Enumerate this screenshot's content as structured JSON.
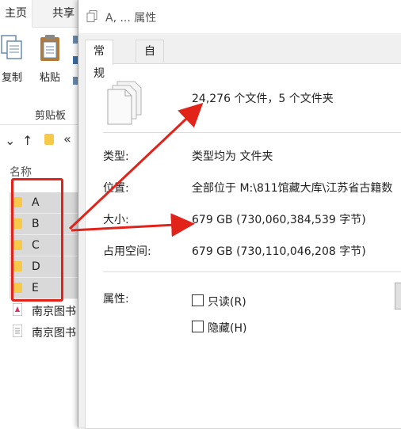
{
  "explorer": {
    "ribbon_tabs": [
      "主页",
      "共享"
    ],
    "ribbon_buttons": {
      "copy": "复制",
      "paste": "粘贴"
    },
    "group_label": "剪贴板",
    "nav_path_glyph": "«",
    "column_header": "名称",
    "folders": [
      "A",
      "B",
      "C",
      "D",
      "E"
    ],
    "files": [
      "南京图书",
      "南京图书"
    ]
  },
  "dialog": {
    "title": "A, ... 属性",
    "tabs": [
      "常规",
      "自定义"
    ],
    "summary": "24,276 个文件，5 个文件夹",
    "rows": [
      {
        "label": "类型:",
        "value": "类型均为 文件夹"
      },
      {
        "label": "位置:",
        "value": "全部位于 M:\\811馆藏大库\\江苏省古籍数"
      },
      {
        "label": "大小:",
        "value": "679 GB (730,060,384,539 字节)"
      },
      {
        "label": "占用空间:",
        "value": "679 GB (730,110,046,208 字节)"
      }
    ],
    "attributes_label": "属性:",
    "checkboxes": [
      {
        "label": "只读(R)",
        "checked": false
      },
      {
        "label": "隐藏(H)",
        "checked": false
      }
    ]
  },
  "colors": {
    "annotation_red": "#e2231a",
    "folder_yellow": "#f7c948",
    "selection_gray": "#d9d9d9"
  }
}
